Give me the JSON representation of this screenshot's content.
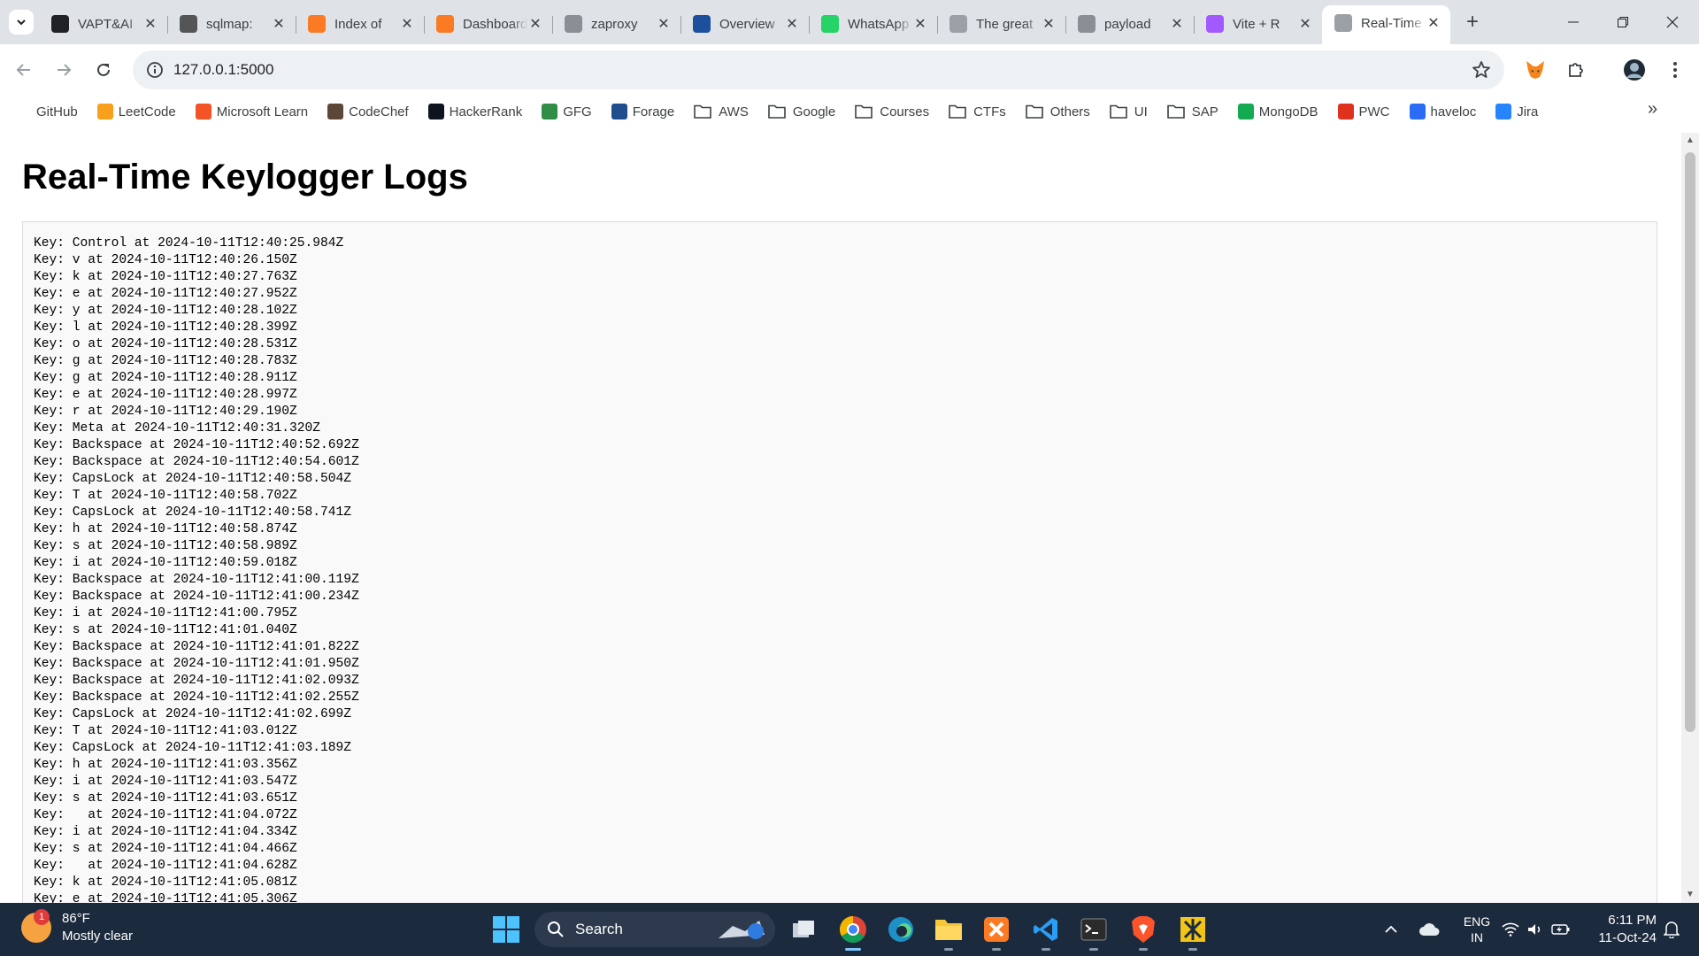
{
  "tabs": [
    {
      "title": "VAPT&AI",
      "favicon": "chatgpt-icon",
      "color": "#202124"
    },
    {
      "title": "sqlmap:",
      "favicon": "sqlmap-icon",
      "color": "#555555"
    },
    {
      "title": "Index of",
      "favicon": "xampp-icon",
      "color": "#fb7a24"
    },
    {
      "title": "Dashboard",
      "favicon": "xampp-icon",
      "color": "#fb7a24"
    },
    {
      "title": "zaproxy",
      "favicon": "github-icon",
      "color": "#8a8f96"
    },
    {
      "title": "Overview",
      "favicon": "zap-icon",
      "color": "#1c4f9c"
    },
    {
      "title": "WhatsApp",
      "favicon": "whatsapp-icon",
      "color": "#25d366"
    },
    {
      "title": "The great",
      "favicon": "link-icon",
      "color": "#9aa0a6"
    },
    {
      "title": "payload",
      "favicon": "github-icon",
      "color": "#8a8f96"
    },
    {
      "title": "Vite + R",
      "favicon": "vite-icon",
      "color": "#a259ff"
    },
    {
      "title": "Real-Time",
      "favicon": "globe-icon",
      "color": "#9aa0a6",
      "active": true
    }
  ],
  "address": {
    "url": "127.0.0.1:5000"
  },
  "bookmarks": [
    {
      "label": "GitHub",
      "icon": "github-icon",
      "type": "link"
    },
    {
      "label": "LeetCode",
      "icon": "leetcode-icon",
      "type": "link"
    },
    {
      "label": "Microsoft Learn",
      "icon": "microsoft-icon",
      "type": "link"
    },
    {
      "label": "CodeChef",
      "icon": "codechef-icon",
      "type": "link"
    },
    {
      "label": "HackerRank",
      "icon": "hackerrank-icon",
      "type": "link"
    },
    {
      "label": "GFG",
      "icon": "gfg-icon",
      "type": "link"
    },
    {
      "label": "Forage",
      "icon": "forage-icon",
      "type": "link"
    },
    {
      "label": "AWS",
      "icon": "folder-icon",
      "type": "folder"
    },
    {
      "label": "Google",
      "icon": "folder-icon",
      "type": "folder"
    },
    {
      "label": "Courses",
      "icon": "folder-icon",
      "type": "folder"
    },
    {
      "label": "CTFs",
      "icon": "folder-icon",
      "type": "folder"
    },
    {
      "label": "Others",
      "icon": "folder-icon",
      "type": "folder"
    },
    {
      "label": "UI",
      "icon": "folder-icon",
      "type": "folder"
    },
    {
      "label": "SAP",
      "icon": "folder-icon",
      "type": "folder"
    },
    {
      "label": "MongoDB",
      "icon": "mongodb-icon",
      "type": "link"
    },
    {
      "label": "PWC",
      "icon": "pwc-icon",
      "type": "link"
    },
    {
      "label": "haveloc",
      "icon": "haveloc-icon",
      "type": "link"
    },
    {
      "label": "Jira",
      "icon": "jira-icon",
      "type": "link"
    }
  ],
  "page": {
    "heading": "Real-Time Keylogger Logs",
    "logs": [
      "Key: Control at 2024-10-11T12:40:25.984Z",
      "Key: v at 2024-10-11T12:40:26.150Z",
      "Key: k at 2024-10-11T12:40:27.763Z",
      "Key: e at 2024-10-11T12:40:27.952Z",
      "Key: y at 2024-10-11T12:40:28.102Z",
      "Key: l at 2024-10-11T12:40:28.399Z",
      "Key: o at 2024-10-11T12:40:28.531Z",
      "Key: g at 2024-10-11T12:40:28.783Z",
      "Key: g at 2024-10-11T12:40:28.911Z",
      "Key: e at 2024-10-11T12:40:28.997Z",
      "Key: r at 2024-10-11T12:40:29.190Z",
      "Key: Meta at 2024-10-11T12:40:31.320Z",
      "Key: Backspace at 2024-10-11T12:40:52.692Z",
      "Key: Backspace at 2024-10-11T12:40:54.601Z",
      "Key: CapsLock at 2024-10-11T12:40:58.504Z",
      "Key: T at 2024-10-11T12:40:58.702Z",
      "Key: CapsLock at 2024-10-11T12:40:58.741Z",
      "Key: h at 2024-10-11T12:40:58.874Z",
      "Key: s at 2024-10-11T12:40:58.989Z",
      "Key: i at 2024-10-11T12:40:59.018Z",
      "Key: Backspace at 2024-10-11T12:41:00.119Z",
      "Key: Backspace at 2024-10-11T12:41:00.234Z",
      "Key: i at 2024-10-11T12:41:00.795Z",
      "Key: s at 2024-10-11T12:41:01.040Z",
      "Key: Backspace at 2024-10-11T12:41:01.822Z",
      "Key: Backspace at 2024-10-11T12:41:01.950Z",
      "Key: Backspace at 2024-10-11T12:41:02.093Z",
      "Key: Backspace at 2024-10-11T12:41:02.255Z",
      "Key: CapsLock at 2024-10-11T12:41:02.699Z",
      "Key: T at 2024-10-11T12:41:03.012Z",
      "Key: CapsLock at 2024-10-11T12:41:03.189Z",
      "Key: h at 2024-10-11T12:41:03.356Z",
      "Key: i at 2024-10-11T12:41:03.547Z",
      "Key: s at 2024-10-11T12:41:03.651Z",
      "Key:   at 2024-10-11T12:41:04.072Z",
      "Key: i at 2024-10-11T12:41:04.334Z",
      "Key: s at 2024-10-11T12:41:04.466Z",
      "Key:   at 2024-10-11T12:41:04.628Z",
      "Key: k at 2024-10-11T12:41:05.081Z",
      "Key: e at 2024-10-11T12:41:05.306Z"
    ]
  },
  "taskbar": {
    "weather_temp": "86°F",
    "weather_desc": "Mostly clear",
    "weather_badge": "1",
    "search_label": "Search",
    "lang_top": "ENG",
    "lang_bottom": "IN",
    "time": "6:11 PM",
    "date": "11-Oct-24"
  },
  "colors": {
    "tabstrip": "#dfe3e7",
    "taskbar": "#1c2a3d",
    "accent": "#1a73e8"
  }
}
